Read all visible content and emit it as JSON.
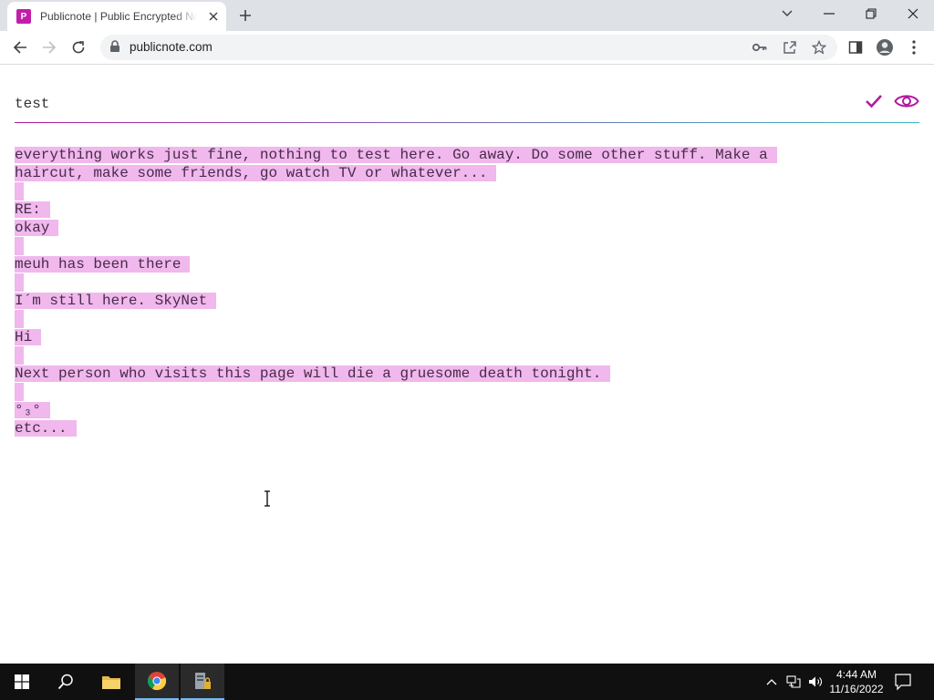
{
  "browser": {
    "tab": {
      "favicon_letter": "P",
      "title": "Publicnote | Public Encrypted Notes"
    },
    "url": "publicnote.com"
  },
  "note": {
    "title": "test",
    "lines": [
      "everything works just fine, nothing to test here. Go away. Do some other stuff. Make a",
      "haircut, make some friends, go watch TV or whatever...",
      "",
      "RE:",
      "okay",
      "",
      "meuh has been there",
      "",
      "I´m still here. SkyNet",
      "",
      "Hi",
      "",
      "Next person who visits this page will die a gruesome death tonight.",
      "",
      "°₃°",
      "etc..."
    ]
  },
  "taskbar": {
    "time": "4:44 AM",
    "date": "11/16/2022"
  },
  "colors": {
    "accent": "#b01aa0",
    "selection": "#f0b8ec",
    "taskbar": "#101010"
  },
  "icons": [
    "windows-start-icon",
    "search-icon",
    "file-explorer-icon",
    "chrome-icon",
    "server-manager-icon",
    "key-icon",
    "share-icon",
    "star-icon",
    "check-icon",
    "eye-icon"
  ]
}
